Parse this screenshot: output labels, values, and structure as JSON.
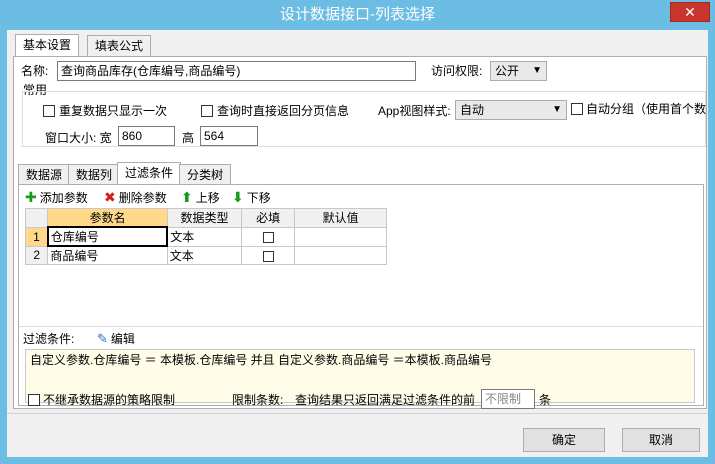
{
  "window": {
    "title": "设计数据接口-列表选择",
    "close_symbol": "✕"
  },
  "top_tabs": [
    {
      "label": "基本设置"
    },
    {
      "label": "填表公式"
    }
  ],
  "basic": {
    "name_label": "名称:",
    "name_value": "查询商品库存(仓库编号,商品编号)",
    "access_label": "访问权限:",
    "access_value": "公开"
  },
  "common": {
    "group_label": "常用",
    "repeat_only_once": "重复数据只显示一次",
    "return_paged_on_query": "查询时直接返回分页信息",
    "app_view_label": "App视图样式:",
    "app_view_value": "自动",
    "auto_group": "自动分组（使用首个数",
    "window_size_label": "窗口大小: 宽",
    "width_value": "860",
    "height_label": "高",
    "height_value": "564"
  },
  "inner_tabs": [
    {
      "label": "数据源"
    },
    {
      "label": "数据列"
    },
    {
      "label": "过滤条件"
    },
    {
      "label": "分类树"
    }
  ],
  "toolbar": {
    "add": "添加参数",
    "delete": "删除参数",
    "up": "上移",
    "down": "下移"
  },
  "params_table": {
    "columns": [
      "参数名",
      "数据类型",
      "必填",
      "默认值"
    ],
    "rows": [
      {
        "num": "1",
        "name": "仓库编号",
        "type": "文本",
        "required": false,
        "default": ""
      },
      {
        "num": "2",
        "name": "商品编号",
        "type": "文本",
        "required": false,
        "default": ""
      }
    ]
  },
  "filter": {
    "label": "过滤条件:",
    "edit": "编辑",
    "expression": "自定义参数.仓库编号 ＝ 本模板.仓库编号 并且 自定义参数.商品编号 ＝本模板.商品编号"
  },
  "footer": {
    "no_inherit": "不继承数据源的策略限制",
    "limit_label": "限制条数:",
    "limit_desc": "查询结果只返回满足过滤条件的前",
    "limit_placeholder": "不限制",
    "limit_suffix": "条"
  },
  "buttons": {
    "ok": "确定",
    "cancel": "取消"
  },
  "colors": {
    "title_bar": "#6cbde3",
    "close": "#c7362c",
    "filter_bg": "#fffde8",
    "active_cell": "#ffd88a"
  }
}
